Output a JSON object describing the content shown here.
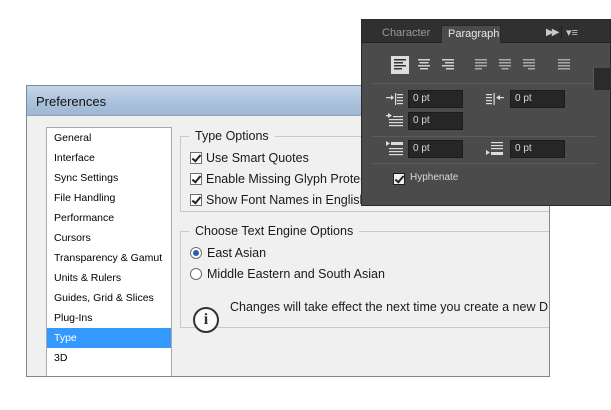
{
  "preferences": {
    "title": "Preferences",
    "categories": [
      "General",
      "Interface",
      "Sync Settings",
      "File Handling",
      "Performance",
      "Cursors",
      "Transparency & Gamut",
      "Units & Rulers",
      "Guides, Grid & Slices",
      "Plug-Ins",
      "Type",
      "3D"
    ],
    "selected_category": "Type",
    "type_options": {
      "legend": "Type Options",
      "use_smart_quotes": "Use Smart Quotes",
      "enable_missing_glyph": "Enable Missing Glyph Protect",
      "show_font_names": "Show Font Names in English"
    },
    "text_engine": {
      "legend": "Choose Text Engine Options",
      "east_asian": "East Asian",
      "middle_eastern": "Middle Eastern and South Asian",
      "selected": "East Asian",
      "info": "Changes will take effect the next time you create a new D"
    }
  },
  "paragraph_panel": {
    "tabs": {
      "character": "Character",
      "paragraph": "Paragraph"
    },
    "active_tab": "Paragraph",
    "indent_left": "0 pt",
    "indent_right": "0 pt",
    "indent_first_line": "0 pt",
    "space_before": "0 pt",
    "space_after": "0 pt",
    "hyphenate_label": "Hyphenate",
    "hyphenate": true,
    "alignment": "left"
  },
  "colors": {
    "selection": "#3399ff",
    "panel_bg": "#4b4b4b",
    "field_bg": "#262626"
  }
}
